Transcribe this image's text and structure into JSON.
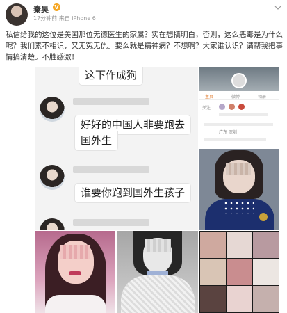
{
  "post": {
    "author": "秦昊",
    "verified_mark": "V",
    "meta": "17分钟前 来自 iPhone 6",
    "text": "私信给我的这位是美国那位无德医生的家属？实在想搞明白，否则，这么恶毒是为什么呢？我们素不相识，又无冤无仇。要么就是精神病？不想啊？大家谁认识？请帮我把事情搞清楚。不胜感激！"
  },
  "chat": {
    "messages": [
      "这下作成狗",
      "好好的中国人非要跑去",
      "国外生",
      "谁要你跑到国外生孩子"
    ]
  },
  "profile": {
    "tabs": [
      "主页",
      "微博",
      "相册"
    ],
    "label_fans": "关注",
    "label_place": "广东 深圳"
  },
  "colors": {
    "verified": "#f5a623",
    "accent_tab": "#e07b2e",
    "chat_bg": "#f3f3f3"
  }
}
